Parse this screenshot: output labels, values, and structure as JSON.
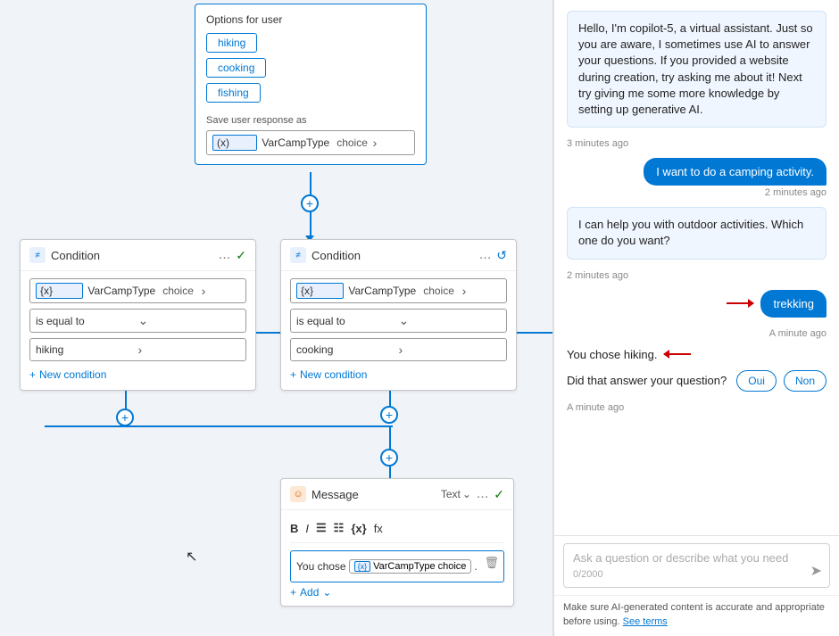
{
  "canvas": {
    "options_card": {
      "title": "Options for user",
      "options": [
        "hiking",
        "cooking",
        "fishing"
      ],
      "save_label": "Save user response as",
      "var_badge": "(x)",
      "var_name": "VarCampType",
      "var_type": "choice"
    },
    "condition1": {
      "title": "Condition",
      "icon": "≠",
      "var_badge": "{x}",
      "var_name": "VarCampType",
      "var_type": "choice",
      "operator": "is equal to",
      "value": "hiking",
      "new_condition": "+ New condition",
      "check_icon": "✓",
      "menu_icon": "..."
    },
    "condition2": {
      "title": "Condition",
      "icon": "≠",
      "var_badge": "{x}",
      "var_name": "VarCampType",
      "var_type": "choice",
      "operator": "is equal to",
      "value": "cooking",
      "new_condition": "+ New condition",
      "refresh_icon": "↺",
      "menu_icon": "..."
    },
    "message_card": {
      "title": "Message",
      "type": "Text",
      "icon": "☺",
      "menu_icon": "...",
      "check_icon": "✓",
      "toolbar": {
        "bold": "B",
        "italic": "I",
        "list1": "☰",
        "list2": "☷",
        "var": "{x}",
        "fn": "fx"
      },
      "content_text": "You chose",
      "var_badge": "{x}",
      "var_name": "VarCampType",
      "var_type": "choice",
      "content_suffix": ".",
      "add_label": "Add",
      "delete_icon": "🗑"
    },
    "plus_labels": [
      "+",
      "+",
      "+",
      "+",
      "+"
    ]
  },
  "chat": {
    "bot_intro": "Hello, I'm copilot-5, a virtual assistant. Just so you are aware, I sometimes use AI to answer your questions. If you provided a website during creation, try asking me about it! Next try giving me some more knowledge by setting up generative AI.",
    "intro_time": "3 minutes ago",
    "user_msg1": "I want to do a camping activity.",
    "user_msg1_time": "2 minutes ago",
    "bot_msg2": "I can help you with outdoor activities. Which one do you want?",
    "bot_msg2_time": "2 minutes ago",
    "user_msg2": "trekking",
    "user_msg2_time": "A minute ago",
    "bot_msg3": "You chose hiking.",
    "bot_msg4": "Did that answer your question?",
    "bot_msg4_time": "A minute ago",
    "btn_oui": "Oui",
    "btn_non": "Non",
    "input_placeholder": "Ask a question or describe what you need",
    "char_count": "0/2000",
    "disclaimer": "Make sure AI-generated content is accurate and appropriate before using.",
    "disclaimer_link": "See terms"
  }
}
